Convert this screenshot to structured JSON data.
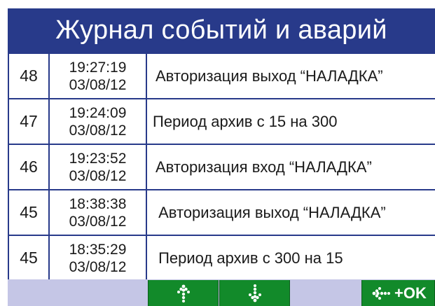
{
  "header": {
    "title": "Журнал событий и аварий"
  },
  "rows": [
    {
      "num": "48",
      "time": "19:27:19",
      "date": "03/08/12",
      "message": "Авторизация выход “НАЛАДКА”"
    },
    {
      "num": "47",
      "time": "19:24:09",
      "date": "03/08/12",
      "message": "Период архив с 15 на 300"
    },
    {
      "num": "46",
      "time": "19:23:52",
      "date": "03/08/12",
      "message": "Авторизация вход “НАЛАДКА”"
    },
    {
      "num": "45",
      "time": "18:38:38",
      "date": "03/08/12",
      "message": " Авторизация выход “НАЛАДКА”"
    },
    {
      "num": "45",
      "time": "18:35:29",
      "date": "03/08/12",
      "message": " Период архив с 300 на 15"
    }
  ],
  "toolbar": {
    "scroll_up_icon": "arrow-up-dotted-icon",
    "scroll_down_icon": "arrow-down-dotted-icon",
    "ok_icon": "arrow-left-dotted-icon",
    "ok_label": "+OK"
  },
  "colors": {
    "header_bg": "#283a8a",
    "grid": "#283a8a",
    "toolbar_bg": "#c5c6e6",
    "button_bg": "#128a2a"
  }
}
